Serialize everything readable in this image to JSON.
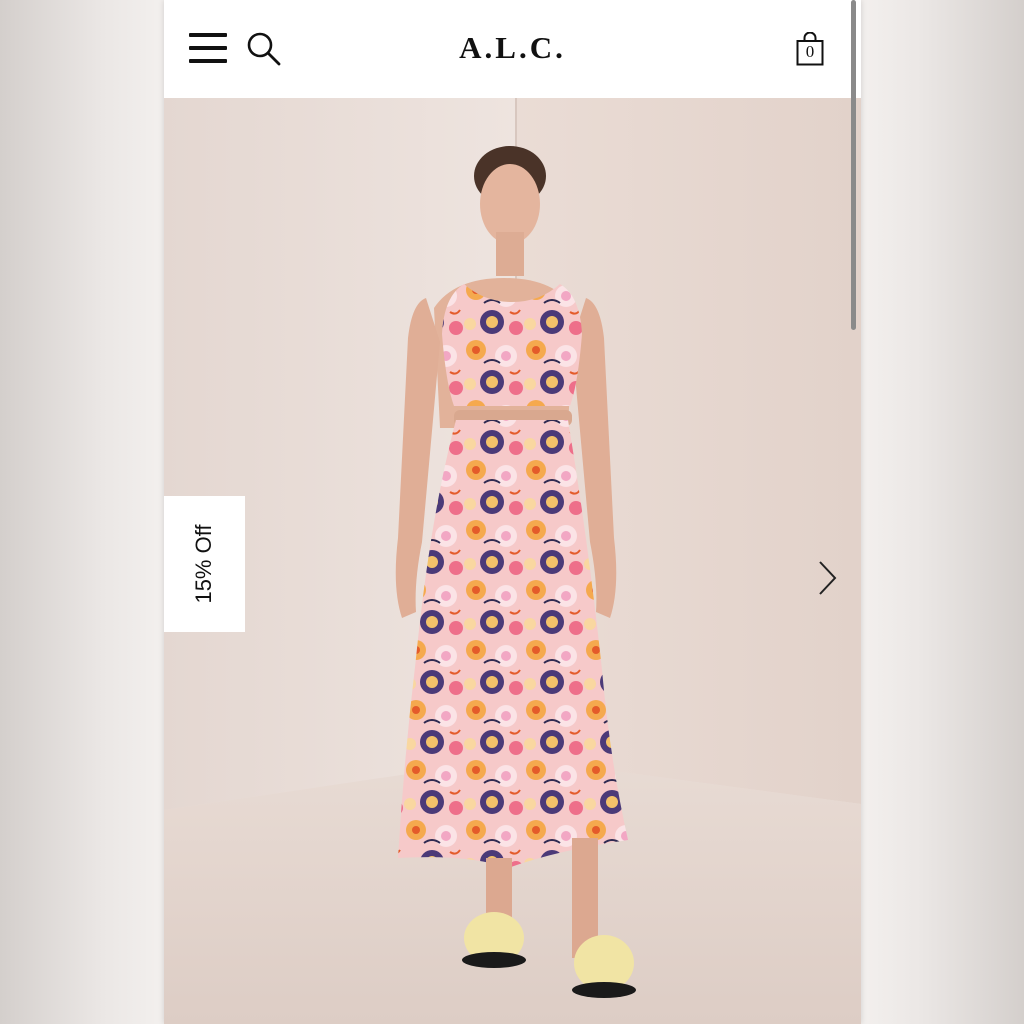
{
  "header": {
    "logo": "A.L.C.",
    "cart_count": "0",
    "menu_icon": "hamburger-menu-icon",
    "search_icon": "search-icon",
    "bag_icon": "shopping-bag-icon"
  },
  "hero": {
    "promo_label": "15% Off",
    "next_icon": "chevron-right-icon",
    "image_subject": "model-wearing-floral-dress"
  },
  "colors": {
    "background_wall": "#e9ddd7",
    "header_bg": "#ffffff",
    "text": "#111111"
  }
}
